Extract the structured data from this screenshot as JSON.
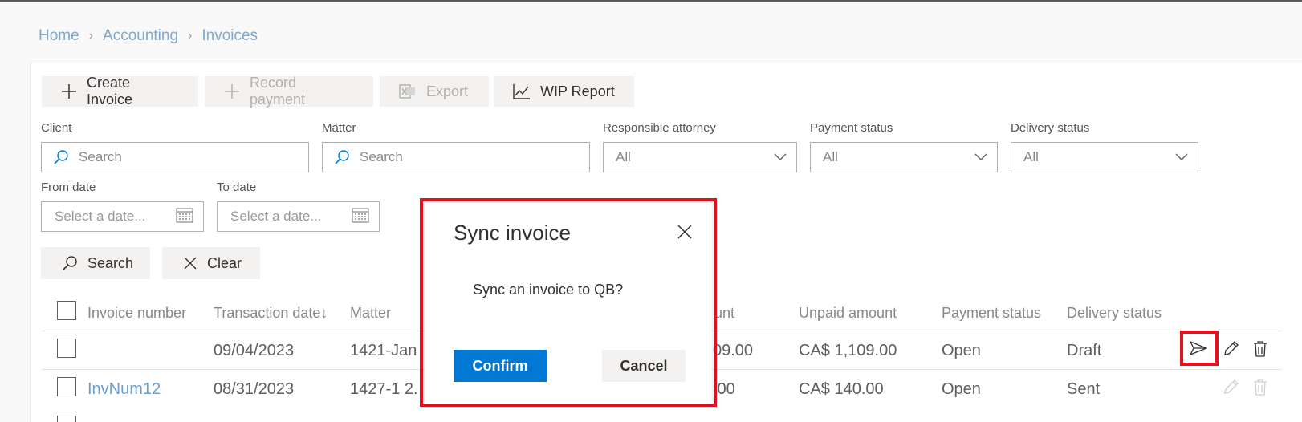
{
  "breadcrumb": {
    "home": "Home",
    "accounting": "Accounting",
    "invoices": "Invoices"
  },
  "toolbar": {
    "create_invoice": "Create Invoice",
    "record_payment": "Record payment",
    "export": "Export",
    "wip_report": "WIP Report"
  },
  "filters": {
    "client_label": "Client",
    "client_placeholder": "Search",
    "matter_label": "Matter",
    "matter_placeholder": "Search",
    "attorney_label": "Responsible attorney",
    "attorney_value": "All",
    "payment_status_label": "Payment status",
    "payment_status_value": "All",
    "delivery_status_label": "Delivery status",
    "delivery_status_value": "All",
    "from_date_label": "From date",
    "from_date_placeholder": "Select a date...",
    "to_date_label": "To date",
    "to_date_placeholder": "Select a date..."
  },
  "actions": {
    "search": "Search",
    "clear": "Clear"
  },
  "table": {
    "headers": {
      "invoice_number": "Invoice number",
      "transaction_date": "Transaction date",
      "sort_indicator": "↓",
      "matter": "Matter",
      "amount_partial": "unt",
      "unpaid_amount": "Unpaid amount",
      "payment_status": "Payment status",
      "delivery_status": "Delivery status"
    },
    "rows": [
      {
        "invoice_number": "",
        "transaction_date": "09/04/2023",
        "matter": "1421-Jan",
        "amount_partial": "09.00",
        "unpaid_amount": "CA$ 1,109.00",
        "payment_status": "Open",
        "delivery_status": "Draft"
      },
      {
        "invoice_number": "InvNum12",
        "transaction_date": "08/31/2023",
        "matter": "1427-1 2.",
        "amount_partial": ".00",
        "unpaid_amount": "CA$ 140.00",
        "payment_status": "Open",
        "delivery_status": "Sent"
      }
    ]
  },
  "dialog": {
    "title": "Sync invoice",
    "message": "Sync an invoice to QB?",
    "confirm": "Confirm",
    "cancel": "Cancel"
  },
  "colors": {
    "primary": "#0078d4",
    "highlight": "#e3121f",
    "link": "#6a9fcf"
  }
}
